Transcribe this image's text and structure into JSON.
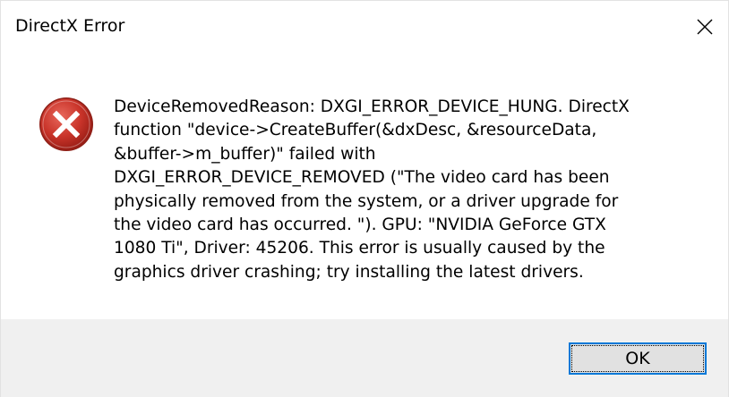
{
  "window": {
    "title": "DirectX Error",
    "close_icon": "close-icon"
  },
  "content": {
    "icon": "error-icon",
    "message": "DeviceRemovedReason: DXGI_ERROR_DEVICE_HUNG. DirectX\nfunction \"device->CreateBuffer(&dxDesc, &resourceData,\n&buffer->m_buffer)\" failed with\nDXGI_ERROR_DEVICE_REMOVED (\"The video card has been\nphysically removed from the system, or a driver upgrade for\nthe video card has occurred. \"). GPU: \"NVIDIA GeForce GTX\n1080 Ti\", Driver: 45206. This error is usually caused by the\ngraphics driver crashing; try installing the latest drivers."
  },
  "buttons": {
    "ok_label": "OK"
  },
  "colors": {
    "accent": "#0078d7",
    "error_red": "#c42b1c",
    "footer_bg": "#f0f0f0"
  }
}
